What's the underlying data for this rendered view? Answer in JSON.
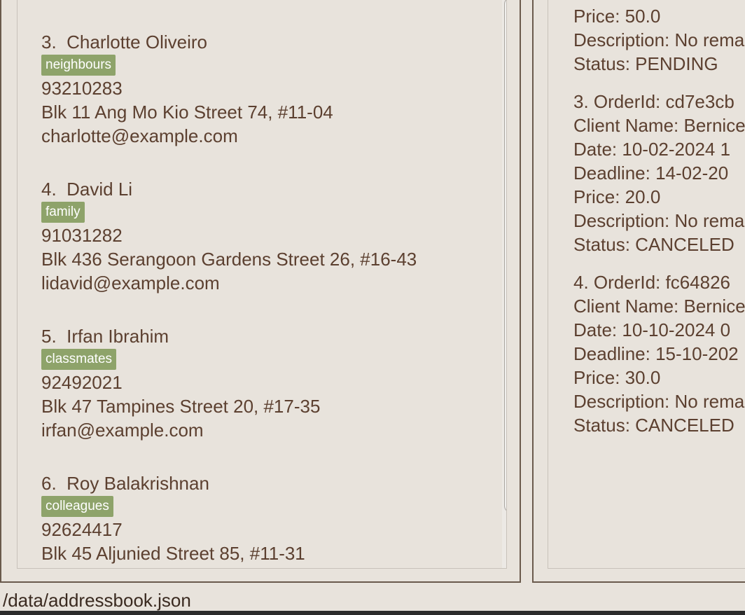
{
  "persons": [
    {
      "index": "3.",
      "name": "Charlotte Oliveiro",
      "tag": "neighbours",
      "phone": "93210283",
      "address": "Blk 11 Ang Mo Kio Street 74, #11-04",
      "email": "charlotte@example.com"
    },
    {
      "index": "4.",
      "name": "David Li",
      "tag": "family",
      "phone": "91031282",
      "address": "Blk 436 Serangoon Gardens Street 26, #16-43",
      "email": "lidavid@example.com"
    },
    {
      "index": "5.",
      "name": "Irfan Ibrahim",
      "tag": "classmates",
      "phone": "92492021",
      "address": "Blk 47 Tampines Street 20, #17-35",
      "email": "irfan@example.com"
    },
    {
      "index": "6.",
      "name": "Roy Balakrishnan",
      "tag": "colleagues",
      "phone": "92624417",
      "address": "Blk 45 Aljunied Street 85, #11-31"
    }
  ],
  "orders": {
    "partial": {
      "price": "Price: 50.0",
      "description": "Description: No rema",
      "status": "Status: PENDING"
    },
    "items": [
      {
        "header": "3.  OrderId: cd7e3cb",
        "client": "Client Name: Bernice",
        "date": "Date: 10-02-2024 1",
        "deadline": "Deadline: 14-02-20",
        "price": "Price: 20.0",
        "description": "Description: No rema",
        "status": "Status: CANCELED"
      },
      {
        "header": "4.  OrderId: fc64826",
        "client": "Client Name: Bernice",
        "date": "Date: 10-10-2024 0",
        "deadline": "Deadline: 15-10-202",
        "price": "Price: 30.0",
        "description": "Description: No rema",
        "status": "Status: CANCELED"
      }
    ]
  },
  "statusbar": {
    "path": "/data/addressbook.json"
  }
}
